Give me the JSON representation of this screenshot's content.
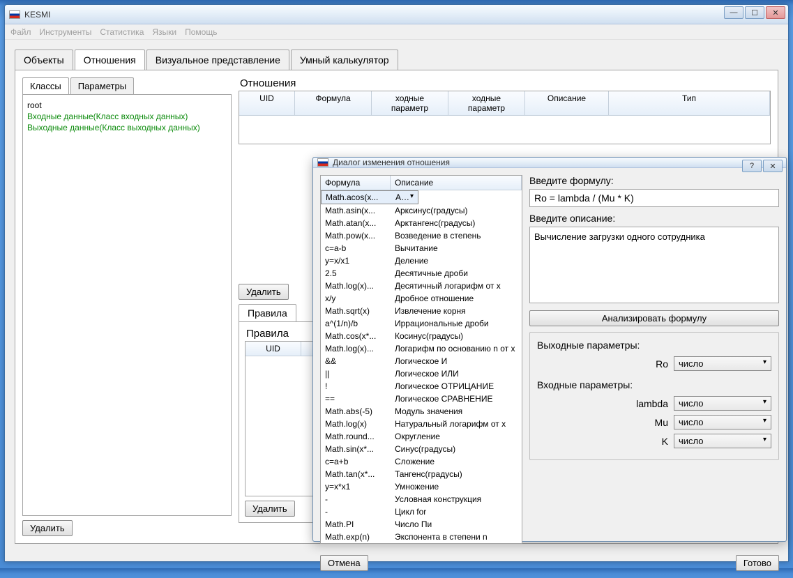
{
  "app": {
    "title": "KESMI"
  },
  "menu": {
    "file": "Файл",
    "tools": "Инструменты",
    "stats": "Статистика",
    "lang": "Языки",
    "help": "Помощь"
  },
  "tabs": {
    "objects": "Объекты",
    "relations": "Отношения",
    "visual": "Визуальное представление",
    "calc": "Умный калькулятор"
  },
  "subtabs": {
    "classes": "Классы",
    "params": "Параметры"
  },
  "tree": {
    "root": "root",
    "inData": "Входные данные(Класс входных данных)",
    "outData": "Выходные данные(Класс выходных данных)"
  },
  "buttons": {
    "delete": "Удалить",
    "cancel": "Отмена",
    "ok": "Готово",
    "analyze": "Анализировать формулу"
  },
  "relPanel": {
    "title": "Отношения",
    "cols": {
      "uid": "UID",
      "formula": "Формула",
      "inP": "ходные параметр",
      "outP": "ходные параметр",
      "desc": "Описание",
      "type": "Тип"
    }
  },
  "rulesTab": "Правила",
  "rulesTitle": "Правила",
  "rulesCols": {
    "uid": "UID"
  },
  "dialog": {
    "title": "Диалог изменения отношения",
    "leftCols": {
      "formula": "Формула",
      "desc": "Описание"
    },
    "items": [
      {
        "f": "Math.acos(x...",
        "d": "Арккосинус(градусы)",
        "sel": true
      },
      {
        "f": "Math.asin(x...",
        "d": "Арксинус(градусы)"
      },
      {
        "f": "Math.atan(x...",
        "d": "Арктангенс(градусы)"
      },
      {
        "f": "Math.pow(x...",
        "d": "Возведение в степень"
      },
      {
        "f": "c=a-b",
        "d": "Вычитание"
      },
      {
        "f": "y=x/x1",
        "d": "Деление"
      },
      {
        "f": "2.5",
        "d": "Десятичные дроби"
      },
      {
        "f": "Math.log(x)...",
        "d": "Десятичный логарифм от x"
      },
      {
        "f": "x/y",
        "d": "Дробное отношение"
      },
      {
        "f": "Math.sqrt(x)",
        "d": "Извлечение корня"
      },
      {
        "f": "a^(1/n)/b",
        "d": "Иррациональные дроби"
      },
      {
        "f": "Math.cos(x*...",
        "d": "Косинус(градусы)"
      },
      {
        "f": "Math.log(x)...",
        "d": "Логарифм по основанию n от x"
      },
      {
        "f": "&&",
        "d": "Логическое И"
      },
      {
        "f": "||",
        "d": "Логическое ИЛИ"
      },
      {
        "f": "!",
        "d": "Логическое ОТРИЦАНИЕ"
      },
      {
        "f": "==",
        "d": "Логическое СРАВНЕНИЕ"
      },
      {
        "f": "Math.abs(-5)",
        "d": "Модуль значения"
      },
      {
        "f": "Math.log(x)",
        "d": "Натуральный логарифм от x"
      },
      {
        "f": "Math.round...",
        "d": "Округление"
      },
      {
        "f": "Math.sin(x*...",
        "d": "Синус(градусы)"
      },
      {
        "f": "c=a+b",
        "d": "Сложение"
      },
      {
        "f": "Math.tan(x*...",
        "d": "Тангенс(градусы)"
      },
      {
        "f": "y=x*x1",
        "d": "Умножение"
      },
      {
        "f": "-",
        "d": "Условная конструкция"
      },
      {
        "f": "-",
        "d": "Цикл for"
      },
      {
        "f": "Math.PI",
        "d": "Число Пи"
      },
      {
        "f": "Math.exp(n)",
        "d": "Экспонента в степени n"
      }
    ],
    "formulaLabel": "Введите формулу:",
    "formulaValue": "Ro = lambda / (Mu * K)",
    "descLabel": "Введите описание:",
    "descValue": "Вычисление загрузки одного сотрудника",
    "outParamsTitle": "Выходные параметры:",
    "inParamsTitle": "Входные параметры:",
    "params": {
      "Ro": "Ro",
      "lambda": "lambda",
      "Mu": "Mu",
      "K": "K"
    },
    "typeOpt": "число"
  }
}
